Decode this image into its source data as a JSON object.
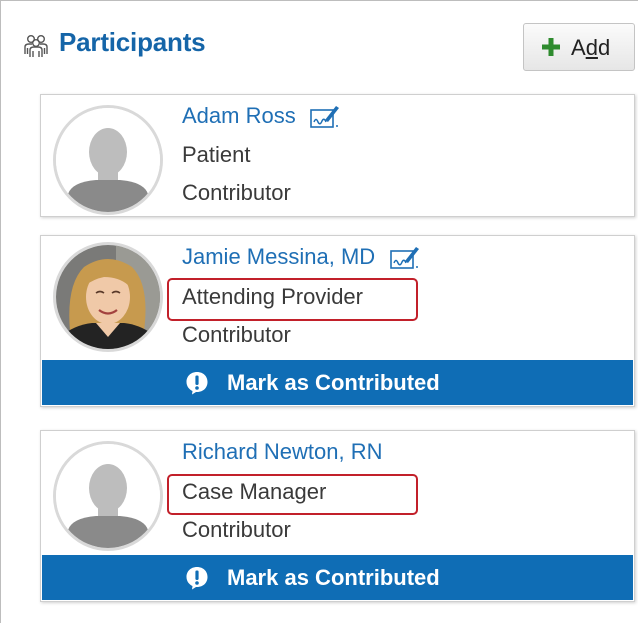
{
  "header": {
    "title": "Participants",
    "icon": "participants-group-icon",
    "add_button": {
      "label_prefix": "A",
      "label_underlined": "d",
      "label_suffix": "d",
      "icon": "plus-icon"
    }
  },
  "colors": {
    "title": "#1565a8",
    "link": "#1f6fb5",
    "action_bar": "#0f6db5",
    "highlight_border": "#c2202a",
    "add_icon": "#2e8b2e"
  },
  "participants": [
    {
      "name": "Adam Ross",
      "role": "Patient",
      "type": "Contributor",
      "avatar": "default-avatar",
      "has_sign_icon": true,
      "action": null,
      "role_highlighted": false
    },
    {
      "name": "Jamie Messina, MD",
      "role": "Attending Provider",
      "type": "Contributor",
      "avatar": "photo-avatar",
      "has_sign_icon": true,
      "action": "Mark as Contributed",
      "role_highlighted": true
    },
    {
      "name": "Richard Newton, RN",
      "role": "Case Manager",
      "type": "Contributor",
      "avatar": "default-avatar",
      "has_sign_icon": false,
      "action": "Mark as Contributed",
      "role_highlighted": true
    }
  ]
}
